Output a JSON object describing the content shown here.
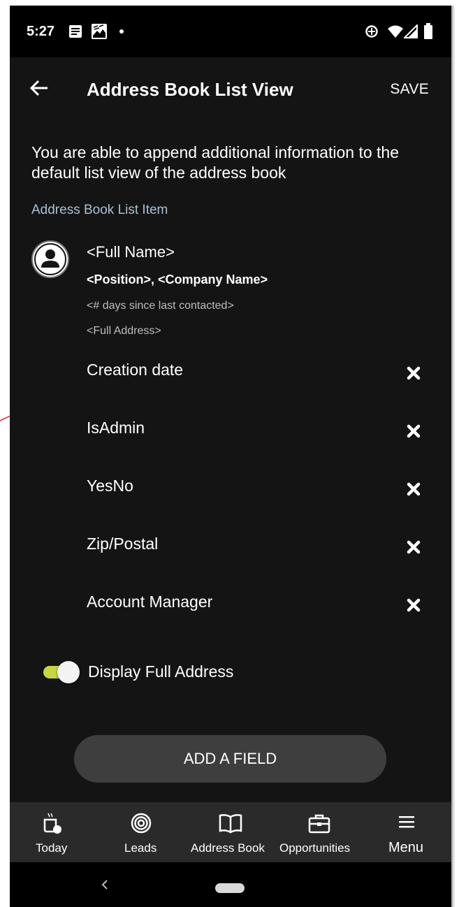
{
  "status_bar": {
    "time": "5:27",
    "icons": [
      "notes-icon",
      "image-icon",
      "dot-icon",
      "sync-icon",
      "wifi-icon",
      "signal-icon",
      "battery-icon"
    ]
  },
  "app_bar": {
    "title": "Address Book List View",
    "save_label": "SAVE",
    "back_icon": "arrow-left-icon"
  },
  "intro_text": "You are able to append additional information to the default list view of the address book",
  "section_label": "Address Book List Item",
  "preview": {
    "full_name": "<Full Name>",
    "position_company": "<Position>, <Company Name>",
    "days_since": "<# days since last contacted>",
    "full_address": "<Full Address>"
  },
  "fields": [
    {
      "label": "Creation date"
    },
    {
      "label": "IsAdmin"
    },
    {
      "label": "YesNo"
    },
    {
      "label": "Zip/Postal"
    },
    {
      "label": "Account Manager"
    }
  ],
  "display_full_address": {
    "label": "Display Full Address",
    "enabled": true,
    "color": "#c6d83b"
  },
  "add_field_label": "ADD A FIELD",
  "bottom_nav": [
    {
      "label": "Today",
      "icon": "coffee-cup-icon"
    },
    {
      "label": "Leads",
      "icon": "target-icon"
    },
    {
      "label": "Address Book",
      "icon": "open-book-icon"
    },
    {
      "label": "Opportunities",
      "icon": "briefcase-icon"
    },
    {
      "label": "Menu",
      "icon": "hamburger-icon"
    }
  ],
  "colors": {
    "background": "#141414",
    "accent": "#c6d83b",
    "section_label": "#a9c2d3",
    "annotation_arrow": "#e02020"
  }
}
